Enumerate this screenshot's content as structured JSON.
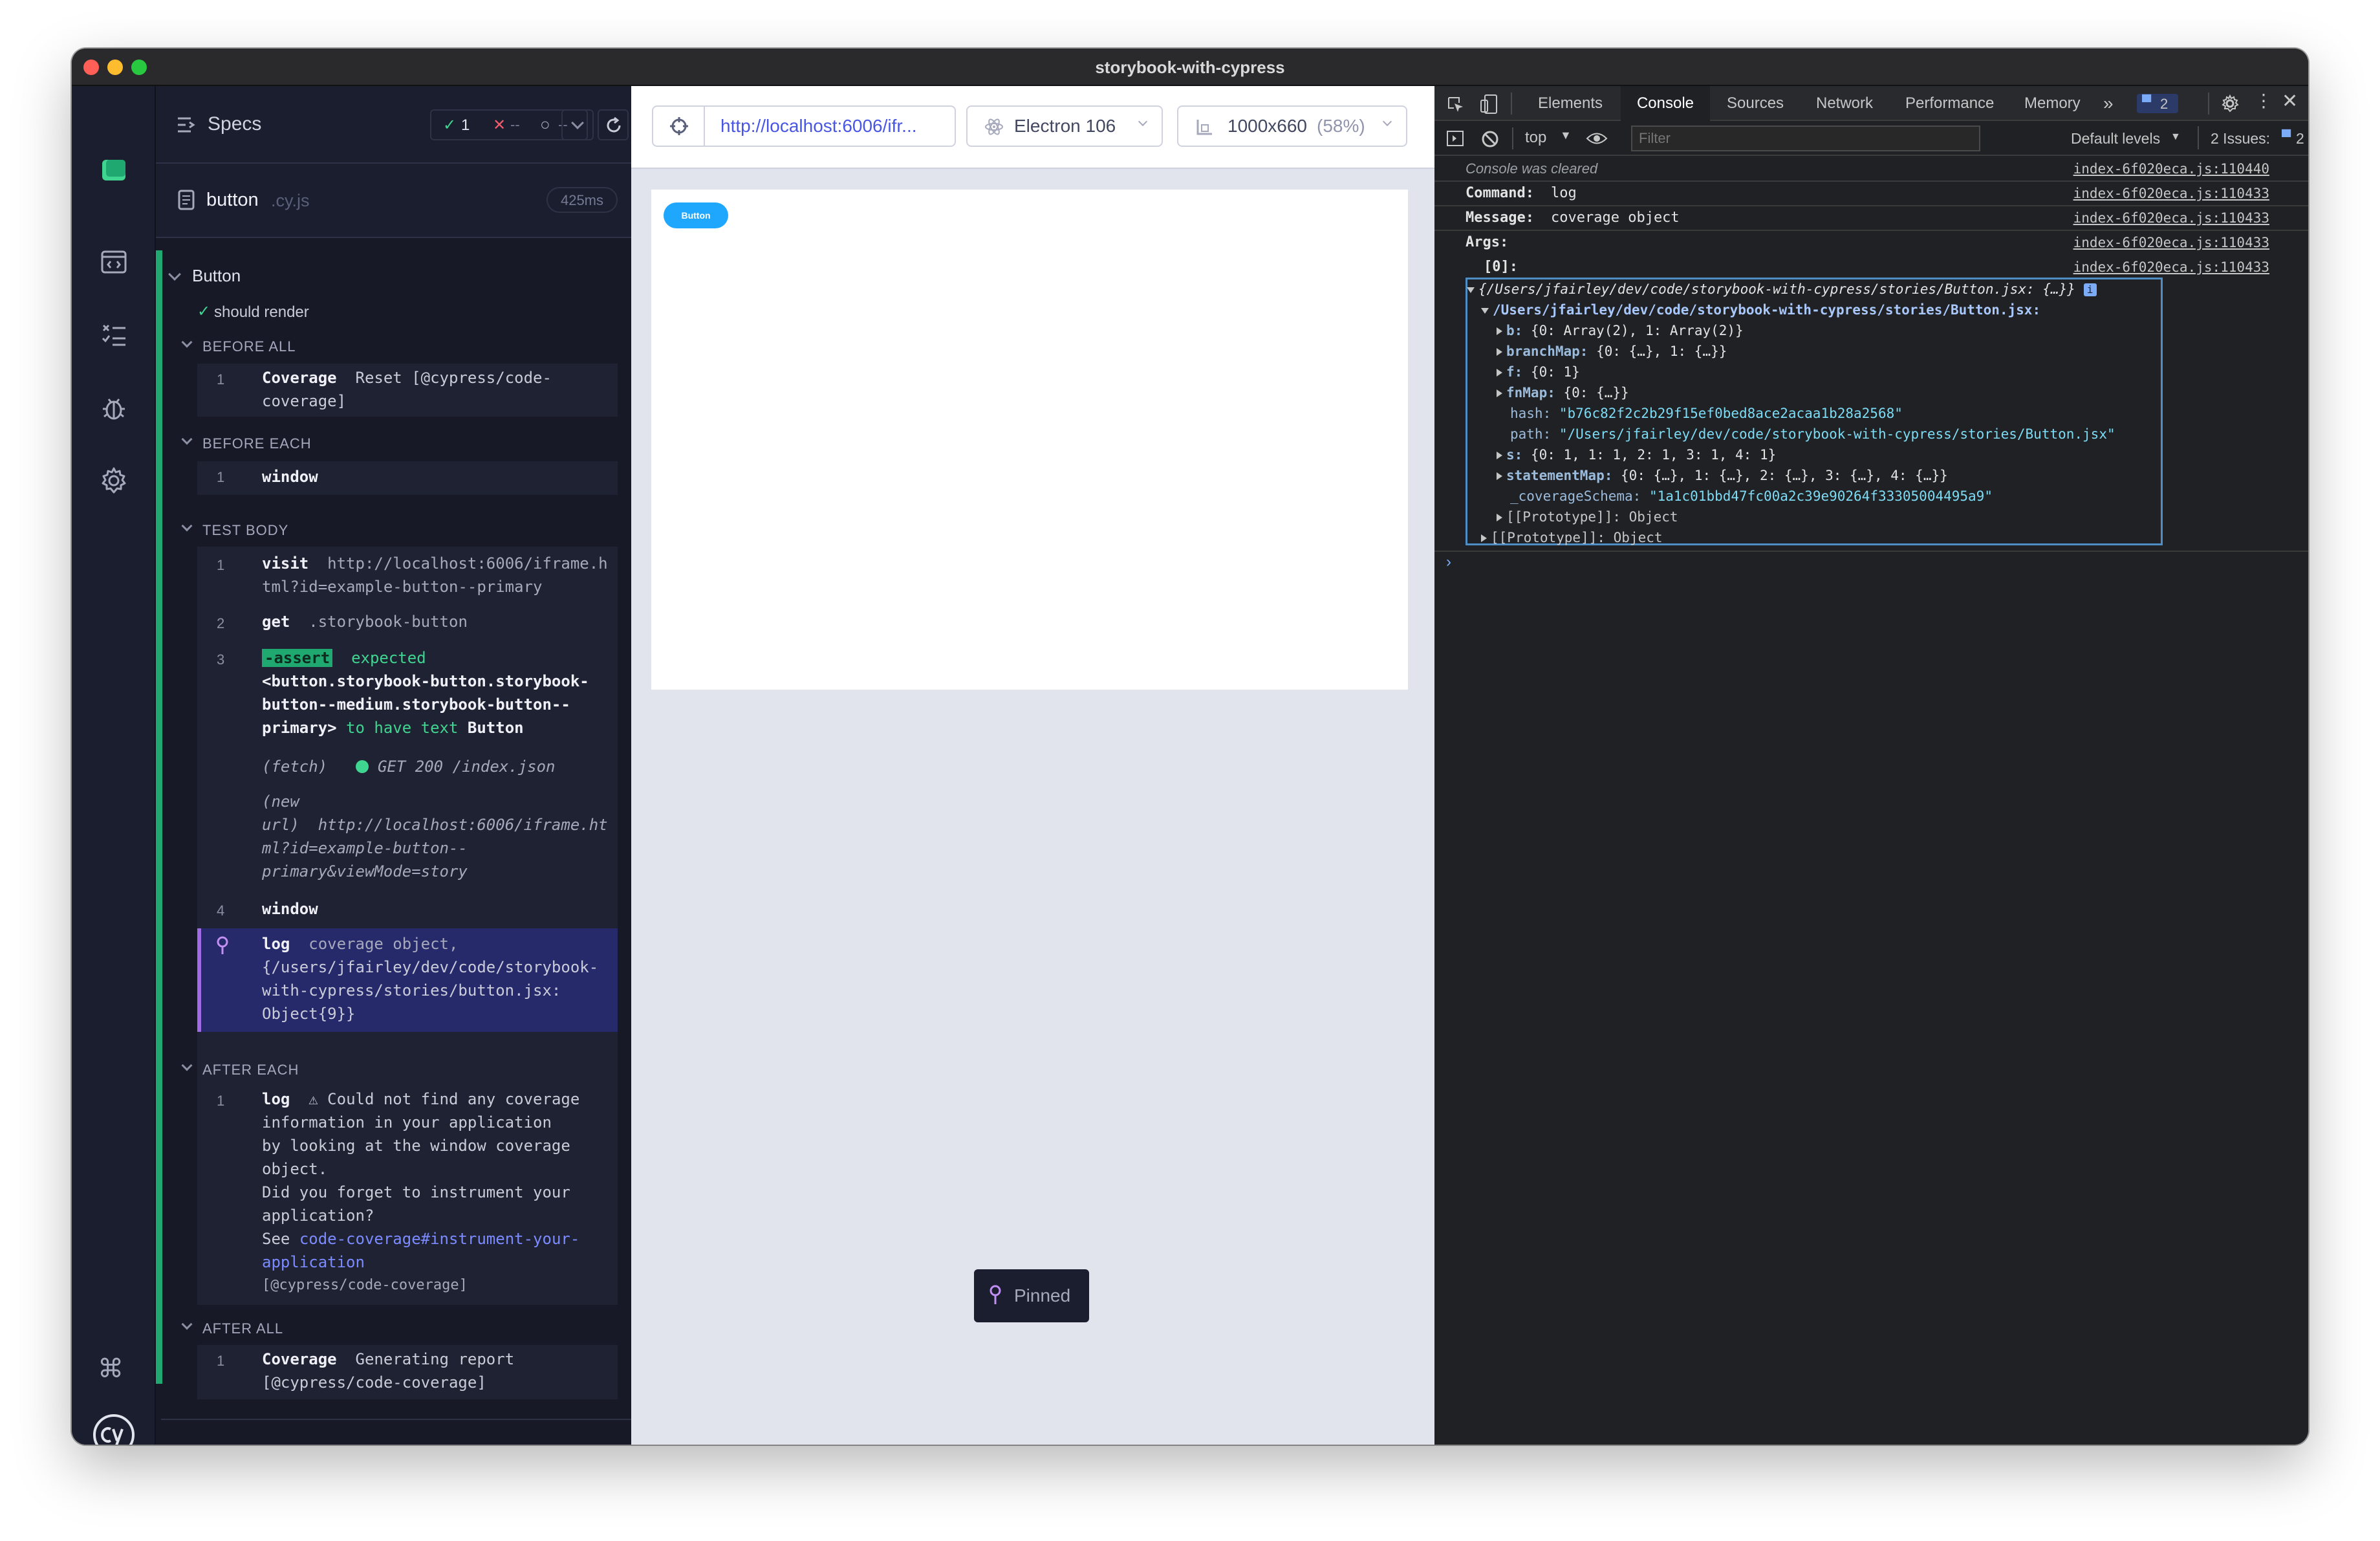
{
  "window": {
    "title": "storybook-with-cypress"
  },
  "reporter": {
    "specs_label": "Specs",
    "stats": {
      "passed": "1",
      "failed": "--",
      "pending": "--"
    },
    "spec": {
      "name": "button",
      "ext": ".cy.js",
      "duration": "425ms"
    },
    "suite": "Button",
    "test": "should render",
    "hooks": {
      "before_all": "BEFORE ALL",
      "before_each": "BEFORE EACH",
      "test_body": "TEST BODY",
      "after_each": "AFTER EACH",
      "after_all": "AFTER ALL"
    },
    "commands": {
      "ba1": {
        "num": "1",
        "name": "Coverage",
        "msg": "Reset [@cypress/code-",
        "msg2": "coverage]"
      },
      "be1": {
        "num": "1",
        "name": "window"
      },
      "tb1": {
        "num": "1",
        "name": "visit",
        "msg": "http://localhost:6006/iframe.h",
        "msg2": "tml?id=example-button--primary"
      },
      "tb2": {
        "num": "2",
        "name": "get",
        "msg": ".storybook-button"
      },
      "tb3": {
        "num": "3",
        "name": "-assert",
        "msg": "expected",
        "msg2": "<button.storybook-button.storybook-",
        "msg3": "button--medium.storybook-button--",
        "msg4": "primary>",
        "msg4b": "to have text",
        "msg4c": "Button"
      },
      "fetch": {
        "name": "(fetch)",
        "msg": "GET 200 /index.json"
      },
      "newurl": {
        "name": "(new",
        "name2": "url)",
        "msg": "http://localhost:6006/iframe.ht",
        "msg2": "ml?id=example-button--",
        "msg3": "primary&viewMode=story"
      },
      "tb4": {
        "num": "4",
        "name": "window"
      },
      "tb5": {
        "name": "log",
        "msg": "coverage object,",
        "msg2": "{/users/jfairley/dev/code/storybook-",
        "msg3": "with-cypress/stories/button.jsx:",
        "msg4": "Object{9}}"
      },
      "ae1": {
        "num": "1",
        "name": "log",
        "msg": "⚠ Could not find any coverage",
        "msg2": "information in your application",
        "msg3": "by looking at the window coverage",
        "msg4": "object.",
        "msg5": "Did you forget to instrument your",
        "msg6": "application?",
        "msg7": "See",
        "link": "code-coverage#instrument-your-",
        "link2": "application",
        "msg8": "[@cypress/code-coverage]"
      },
      "aa1": {
        "num": "1",
        "name": "Coverage",
        "msg": "Generating report",
        "msg2": "[@cypress/code-coverage]"
      }
    }
  },
  "aut": {
    "url": "http://localhost:6006/ifr...",
    "browser": "Electron 106",
    "viewport": "1000x660",
    "scale": "(58%)",
    "button_label": "Button",
    "pinned_label": "Pinned"
  },
  "devtools": {
    "tabs": [
      "Elements",
      "Console",
      "Sources",
      "Network",
      "Performance",
      "Memory"
    ],
    "active_tab": "Console",
    "messages_badge": "2",
    "context": "top",
    "filter_placeholder": "Filter",
    "levels": "Default levels",
    "issues_label": "2 Issues:",
    "issues_count": "2",
    "console": {
      "cleared": "Console was cleared",
      "src1": "index-6f020eca.js:110440",
      "command_key": "Command:",
      "command_val": "log",
      "message_key": "Message:",
      "message_val": "coverage object",
      "args_key": "Args:",
      "arg0": "[0]:",
      "src2": "index-6f020eca.js:110433",
      "tree": {
        "root": "{/Users/jfairley/dev/code/storybook-with-cypress/stories/Button.jsx: {…}}",
        "file": "/Users/jfairley/dev/code/storybook-with-cypress/stories/Button.jsx:",
        "b_key": "b:",
        "b_val": "{0: Array(2), 1: Array(2)}",
        "branchMap_key": "branchMap:",
        "branchMap_val": "{0: {…}, 1: {…}}",
        "f_key": "f:",
        "f_val": "{0: 1}",
        "fnMap_key": "fnMap:",
        "fnMap_val": "{0: {…}}",
        "hash_key": "hash:",
        "hash_val": "\"b76c82f2c2b29f15ef0bed8ace2acaa1b28a2568\"",
        "path_key": "path:",
        "path_val": "\"/Users/jfairley/dev/code/storybook-with-cypress/stories/Button.jsx\"",
        "s_key": "s:",
        "s_val": "{0: 1, 1: 1, 2: 1, 3: 1, 4: 1}",
        "statementMap_key": "statementMap:",
        "statementMap_val": "{0: {…}, 1: {…}, 2: {…}, 3: {…}, 4: {…}}",
        "schema_key": "_coverageSchema:",
        "schema_val": "\"1a1c01bbd47fc00a2c39e90264f33305004495a9\"",
        "proto_inner": "[[Prototype]]: Object",
        "proto_outer": "[[Prototype]]: Object"
      }
    }
  }
}
